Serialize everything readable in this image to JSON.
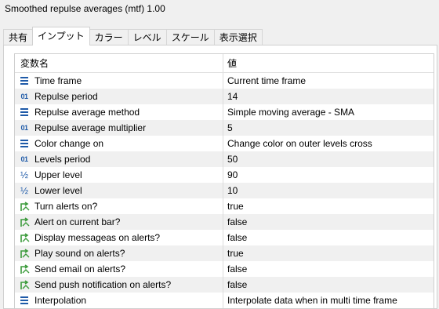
{
  "window": {
    "title": "Smoothed repulse averages (mtf) 1.00"
  },
  "tabs": [
    {
      "label": "共有",
      "active": false
    },
    {
      "label": "インプット",
      "active": true
    },
    {
      "label": "カラー",
      "active": false
    },
    {
      "label": "レベル",
      "active": false
    },
    {
      "label": "スケール",
      "active": false
    },
    {
      "label": "表示選択",
      "active": false
    }
  ],
  "table": {
    "headers": {
      "name": "変数名",
      "value": "値"
    },
    "rows": [
      {
        "icon": "list-icon",
        "name": "Time frame",
        "value": "Current time frame"
      },
      {
        "icon": "integer-icon",
        "icon_text": "01",
        "name": "Repulse period",
        "value": "14"
      },
      {
        "icon": "list-icon",
        "name": "Repulse average method",
        "value": "Simple moving average - SMA"
      },
      {
        "icon": "integer-icon",
        "icon_text": "01",
        "name": "Repulse average multiplier",
        "value": "5"
      },
      {
        "icon": "list-icon",
        "name": "Color change on",
        "value": "Change color on outer levels cross"
      },
      {
        "icon": "integer-icon",
        "icon_text": "01",
        "name": "Levels period",
        "value": "50"
      },
      {
        "icon": "fraction-icon",
        "icon_text": "½",
        "name": "Upper level",
        "value": "90"
      },
      {
        "icon": "fraction-icon",
        "icon_text": "½",
        "name": "Lower level",
        "value": "10"
      },
      {
        "icon": "boolean-icon",
        "name": "Turn alerts on?",
        "value": "true"
      },
      {
        "icon": "boolean-icon",
        "name": "Alert on current bar?",
        "value": "false"
      },
      {
        "icon": "boolean-icon",
        "name": "Display messageas on alerts?",
        "value": "false"
      },
      {
        "icon": "boolean-icon",
        "name": "Play sound on alerts?",
        "value": "true"
      },
      {
        "icon": "boolean-icon",
        "name": "Send email on alerts?",
        "value": "false"
      },
      {
        "icon": "boolean-icon",
        "name": "Send push notification on alerts?",
        "value": "false"
      },
      {
        "icon": "list-icon",
        "name": "Interpolation",
        "value": "Interpolate data when in multi time frame"
      }
    ]
  },
  "colors": {
    "icon_blue": "#1e5aa8",
    "icon_green": "#3a9a3a",
    "row_alt": "#f0f0f0"
  }
}
